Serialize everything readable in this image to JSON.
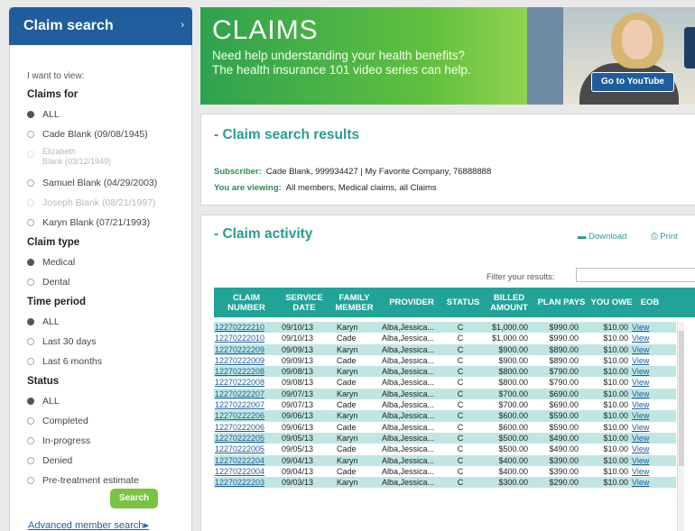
{
  "left": {
    "title": "Claim search",
    "view_label": "I want to view:",
    "claims_for": {
      "heading": "Claims for",
      "options": [
        {
          "label": "ALL",
          "selected": true,
          "disabled": false
        },
        {
          "label": "Cade Blank (09/08/1945)",
          "selected": false,
          "disabled": false
        },
        {
          "label_line1": "Elizabeth",
          "label_line2": "Blank (03/12/1949)",
          "selected": false,
          "disabled": true
        },
        {
          "label": "Samuel Blank (04/29/2003)",
          "selected": false,
          "disabled": false
        },
        {
          "label": "Joseph Blank (08/21/1997)",
          "selected": false,
          "disabled": true
        },
        {
          "label": "Karyn Blank (07/21/1993)",
          "selected": false,
          "disabled": false
        }
      ]
    },
    "claim_type": {
      "heading": "Claim type",
      "options": [
        {
          "label": "Medical",
          "selected": true
        },
        {
          "label": "Dental",
          "selected": false
        }
      ]
    },
    "time_period": {
      "heading": "Time period",
      "options": [
        {
          "label": "ALL",
          "selected": true
        },
        {
          "label": "Last 30 days",
          "selected": false
        },
        {
          "label": "Last 6 months",
          "selected": false
        }
      ]
    },
    "status": {
      "heading": "Status",
      "options": [
        {
          "label": "ALL",
          "selected": true
        },
        {
          "label": "Completed",
          "selected": false
        },
        {
          "label": "In-progress",
          "selected": false
        },
        {
          "label": "Denied",
          "selected": false
        },
        {
          "label": "Pre-treatment estimate",
          "selected": false
        }
      ]
    },
    "search_button": "Search",
    "advanced_link": "Advanced member search"
  },
  "banner": {
    "title": "CLAIMS",
    "line1": "Need help understanding your health benefits?",
    "line2": "The health insurance 101 video series can help.",
    "button": "Go to YouTube"
  },
  "results": {
    "title": "Claim search results",
    "subscriber_label": "Subscriber:",
    "subscriber_value": "Cade Blank, 999934427 | My Favorite Company, 76888888",
    "viewing_label": "You are viewing:",
    "viewing_value": "All members, Medical claims, all Claims"
  },
  "activity": {
    "title": "Claim activity",
    "download": "Download",
    "print": "Print",
    "filter_label": "Filter your results:",
    "filter_value": "",
    "columns": [
      "CLAIM NUMBER",
      "SERVICE DATE",
      "FAMILY MEMBER",
      "PROVIDER",
      "STATUS",
      "BILLED AMOUNT",
      "PLAN PAYS",
      "YOU OWE",
      "EOB"
    ],
    "rows": [
      {
        "claim": "12270222210",
        "date": "09/10/13",
        "member": "Karyn",
        "provider": "Alba,Jessica...",
        "status": "C",
        "billed": "$1,000.00",
        "plan": "$990.00",
        "owe": "$10.00",
        "eob": "View"
      },
      {
        "claim": "12270222010",
        "date": "09/10/13",
        "member": "Cade",
        "provider": "Alba,Jessica...",
        "status": "C",
        "billed": "$1,000.00",
        "plan": "$990.00",
        "owe": "$10.00",
        "eob": "View"
      },
      {
        "claim": "12270222209",
        "date": "09/09/13",
        "member": "Karyn",
        "provider": "Alba,Jessica...",
        "status": "C",
        "billed": "$900.00",
        "plan": "$890.00",
        "owe": "$10.00",
        "eob": "View"
      },
      {
        "claim": "12270222009",
        "date": "09/09/13",
        "member": "Cade",
        "provider": "Alba,Jessica...",
        "status": "C",
        "billed": "$900.00",
        "plan": "$890.00",
        "owe": "$10.00",
        "eob": "View"
      },
      {
        "claim": "12270222208",
        "date": "09/08/13",
        "member": "Karyn",
        "provider": "Alba,Jessica...",
        "status": "C",
        "billed": "$800.00",
        "plan": "$790.00",
        "owe": "$10.00",
        "eob": "View"
      },
      {
        "claim": "12270222008",
        "date": "09/08/13",
        "member": "Cade",
        "provider": "Alba,Jessica...",
        "status": "C",
        "billed": "$800.00",
        "plan": "$790.00",
        "owe": "$10.00",
        "eob": "View"
      },
      {
        "claim": "12270222207",
        "date": "09/07/13",
        "member": "Karyn",
        "provider": "Alba,Jessica...",
        "status": "C",
        "billed": "$700.00",
        "plan": "$690.00",
        "owe": "$10.00",
        "eob": "View"
      },
      {
        "claim": "12270222007",
        "date": "09/07/13",
        "member": "Cade",
        "provider": "Alba,Jessica...",
        "status": "C",
        "billed": "$700.00",
        "plan": "$690.00",
        "owe": "$10.00",
        "eob": "View"
      },
      {
        "claim": "12270222206",
        "date": "09/06/13",
        "member": "Karyn",
        "provider": "Alba,Jessica...",
        "status": "C",
        "billed": "$600.00",
        "plan": "$590.00",
        "owe": "$10.00",
        "eob": "View"
      },
      {
        "claim": "12270222006",
        "date": "09/06/13",
        "member": "Cade",
        "provider": "Alba,Jessica...",
        "status": "C",
        "billed": "$600.00",
        "plan": "$590.00",
        "owe": "$10.00",
        "eob": "View"
      },
      {
        "claim": "12270222205",
        "date": "09/05/13",
        "member": "Karyn",
        "provider": "Alba,Jessica...",
        "status": "C",
        "billed": "$500.00",
        "plan": "$490.00",
        "owe": "$10.00",
        "eob": "View"
      },
      {
        "claim": "12270222005",
        "date": "09/05/13",
        "member": "Cade",
        "provider": "Alba,Jessica...",
        "status": "C",
        "billed": "$500.00",
        "plan": "$490.00",
        "owe": "$10.00",
        "eob": "View"
      },
      {
        "claim": "12270222204",
        "date": "09/04/13",
        "member": "Karyn",
        "provider": "Alba,Jessica...",
        "status": "C",
        "billed": "$400.00",
        "plan": "$390.00",
        "owe": "$10.00",
        "eob": "View"
      },
      {
        "claim": "12270222004",
        "date": "09/04/13",
        "member": "Cade",
        "provider": "Alba,Jessica...",
        "status": "C",
        "billed": "$400.00",
        "plan": "$390.00",
        "owe": "$10.00",
        "eob": "View"
      },
      {
        "claim": "12270222203",
        "date": "09/03/13",
        "member": "Karyn",
        "provider": "Alba,Jessica...",
        "status": "C",
        "billed": "$300.00",
        "plan": "$290.00",
        "owe": "$10.00",
        "eob": "View"
      }
    ]
  },
  "colors": {
    "brand_blue": "#1f5d9c",
    "teal": "#22a398",
    "row_highlight": "#bfe6e2",
    "banner_green": "#5fbf3f",
    "search_green": "#7cc243"
  }
}
